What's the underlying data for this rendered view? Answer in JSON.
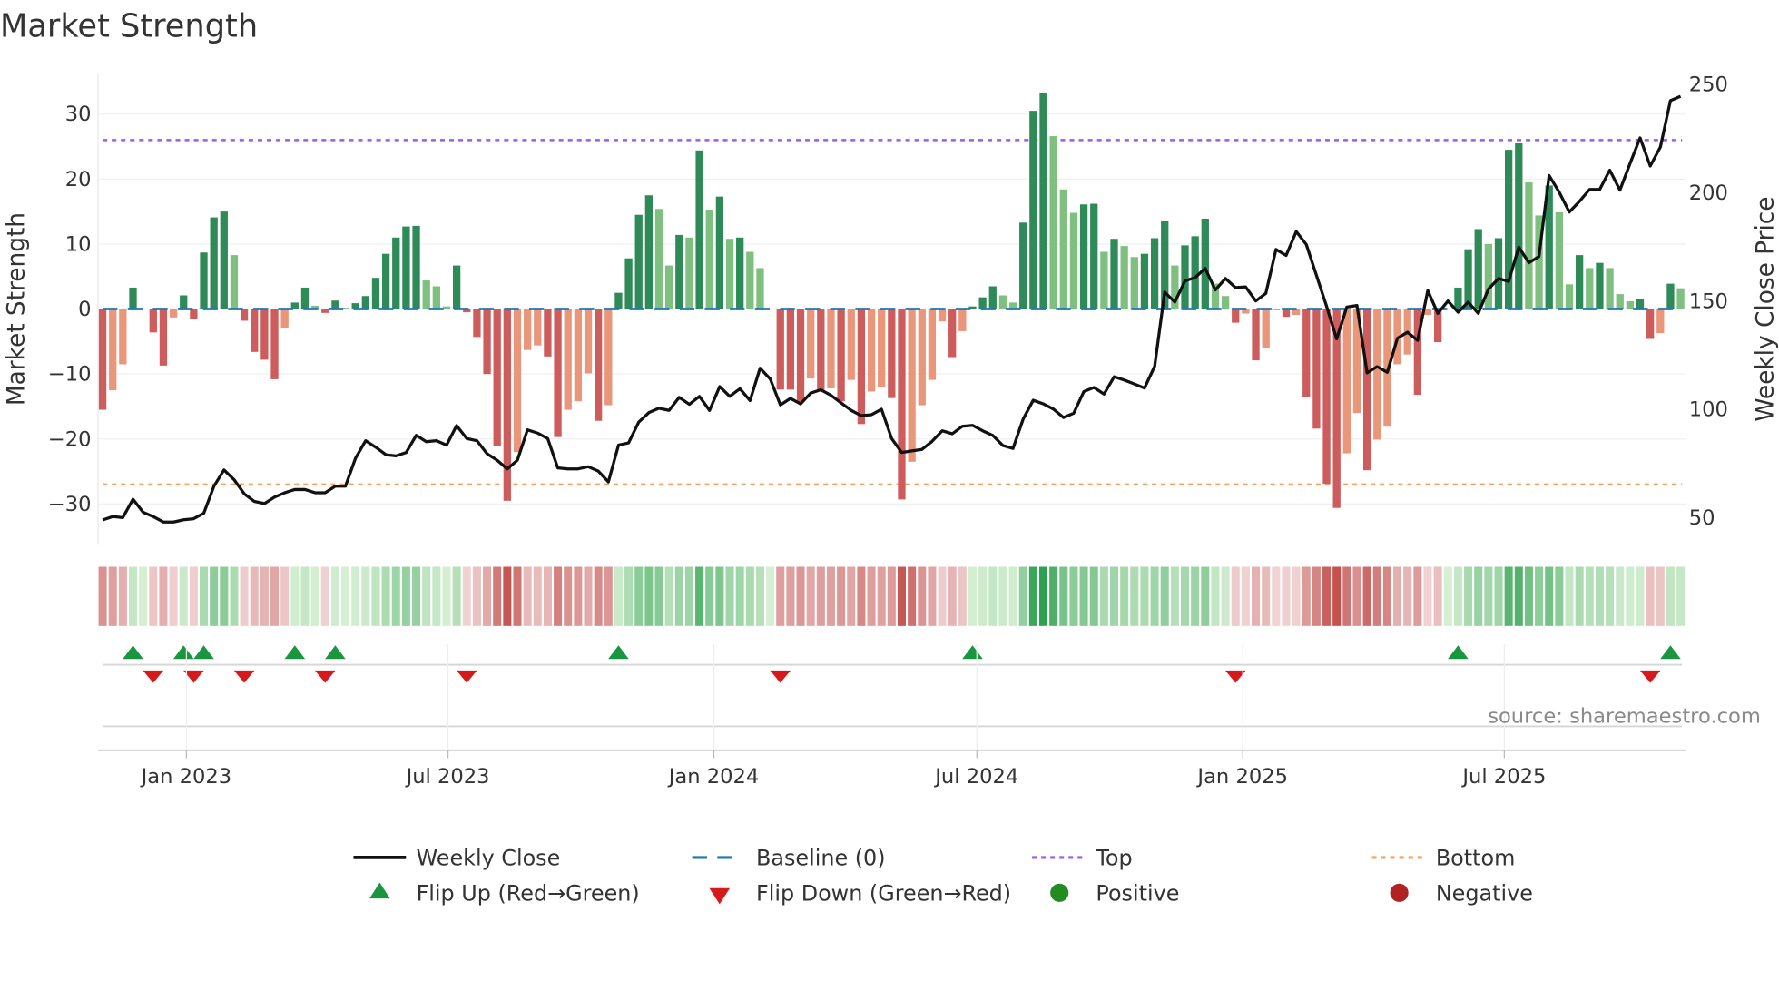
{
  "title": "Market Strength",
  "source": "source: sharemaestro.com",
  "chart_data": {
    "type": "bar",
    "title": "Market Strength",
    "ylabel": "Market Strength",
    "y2label": "Weekly Close Price",
    "ylim": [
      -36,
      37
    ],
    "y2lim": [
      48,
      260
    ],
    "yticks": [
      30,
      20,
      10,
      0,
      -10,
      -20,
      -30
    ],
    "y2ticks": [
      250,
      200,
      150,
      100,
      50
    ],
    "xticks": [
      {
        "label": "Jan 2023",
        "date": "2023-01-01"
      },
      {
        "label": "Jul 2023",
        "date": "2023-07-01"
      },
      {
        "label": "Jan 2024",
        "date": "2024-01-01"
      },
      {
        "label": "Jul 2024",
        "date": "2024-07-01"
      },
      {
        "label": "Jan 2025",
        "date": "2025-01-01"
      },
      {
        "label": "Jul 2025",
        "date": "2025-07-01"
      }
    ],
    "start_date": "2022-11-04",
    "interval_days": 7,
    "grid": true,
    "top_level": 26,
    "bottom_level": -27,
    "baseline": 0,
    "strength": [
      -15.5,
      -12.5,
      -8.5,
      3.3,
      0,
      -3.6,
      -8.7,
      -1.3,
      2.1,
      -1.6,
      8.7,
      14.1,
      15,
      8.3,
      -1.8,
      -6.6,
      -7.8,
      -10.8,
      -3,
      1,
      3.3,
      0.5,
      -0.6,
      1.3,
      0.2,
      0.9,
      2,
      4.8,
      8.5,
      11,
      12.7,
      12.8,
      4.4,
      3.5,
      0.4,
      6.7,
      -0.5,
      -4.3,
      -10,
      -21,
      -29.5,
      -22,
      -6.3,
      -5.6,
      -7.3,
      -19.7,
      -15.5,
      -14.2,
      -9.9,
      -17.2,
      -14.8,
      2.5,
      7.8,
      14.5,
      17.5,
      15.4,
      6.7,
      11.4,
      11,
      24.4,
      15.3,
      17.3,
      10.8,
      11,
      8.8,
      6.3,
      0,
      -12.4,
      -12.4,
      -14.3,
      -10.7,
      -12.4,
      -12.2,
      -14.2,
      -10.9,
      -17.7,
      -12.7,
      -12,
      -13.7,
      -29.3,
      -23.5,
      -14.8,
      -10.9,
      -1.9,
      -7.4,
      -3.4,
      0.4,
      1.8,
      3.5,
      2.1,
      1,
      13.3,
      30.5,
      33.3,
      26.6,
      18.4,
      14.8,
      16.1,
      16.2,
      8.8,
      10.8,
      9.7,
      8,
      8.5,
      10.9,
      13.6,
      6.7,
      9.8,
      11.2,
      13.9,
      3.9,
      2,
      -2.1,
      -0.7,
      -7.9,
      -6,
      -0.2,
      -1.2,
      -0.9,
      -13.6,
      -18.4,
      -26.9,
      -30.6,
      -22.2,
      -16,
      -24.8,
      -20.1,
      -18.1,
      -8.5,
      -7,
      -13.2,
      -0.9,
      -5.1,
      0,
      3.3,
      9.2,
      12.3,
      10,
      10.9,
      24.5,
      25.5,
      19.5,
      14.4,
      19,
      14.9,
      3.8,
      8.3,
      6.3,
      7.1,
      6.3,
      2.3,
      1.2,
      1.6,
      -4.6,
      -3.7,
      3.9,
      3.2
    ],
    "weekly_close": [
      48.4,
      50,
      49.5,
      58,
      52,
      50,
      47.5,
      47.5,
      48.5,
      49,
      51.5,
      64,
      71.5,
      67,
      60.5,
      57,
      56,
      59,
      61,
      62.5,
      62.5,
      61,
      61,
      64,
      64,
      77,
      85,
      82,
      78.5,
      78,
      79.5,
      87.5,
      84.5,
      85,
      83,
      92,
      86,
      85,
      79,
      76,
      72,
      76,
      90,
      88.5,
      86,
      72.5,
      72,
      72,
      73,
      71,
      66,
      83,
      84,
      93.6,
      98,
      100,
      99,
      105,
      101.8,
      105.5,
      99,
      110,
      105.5,
      109,
      103.5,
      118.5,
      113.5,
      101.5,
      104.5,
      102,
      107,
      108.5,
      106,
      102.5,
      99,
      96.6,
      97,
      99.5,
      86,
      79.6,
      80.3,
      81,
      84.7,
      89.6,
      88.2,
      91.7,
      92.1,
      89.6,
      87.4,
      82.8,
      81.4,
      95,
      103.7,
      102,
      99.6,
      95.7,
      97.7,
      107.7,
      109.6,
      106.5,
      114.5,
      113,
      111.2,
      109.3,
      119.3,
      153.6,
      149,
      158.8,
      160.3,
      164.6,
      154.6,
      159.9,
      155.7,
      156,
      149.5,
      153,
      173.3,
      170.5,
      181.6,
      175.6,
      161.3,
      147,
      132,
      146.7,
      147.4,
      116.3,
      119.2,
      116.6,
      132.3,
      135.1,
      131.3,
      154.3,
      143.8,
      149.5,
      144.3,
      149,
      143.8,
      155,
      159.9,
      158.5,
      174.3,
      167.2,
      170,
      207.4,
      199.7,
      190.6,
      195.5,
      201,
      201,
      209.9,
      200.7,
      213,
      224.8,
      211.8,
      220.6,
      242,
      244
    ],
    "flip_up_weeks": [
      3,
      8,
      10,
      19,
      23,
      51,
      86,
      134,
      155
    ],
    "flip_down_weeks": [
      5,
      9,
      14,
      22,
      36,
      67,
      112,
      153
    ],
    "colors": {
      "pos_strong": "#2e8b57",
      "pos_weak": "#7fbf7f",
      "neg_strong": "#cd5c5c",
      "neg_weak": "#e9967a",
      "baseline": "#1f77b4",
      "top": "#9b5de5",
      "bottom": "#f4a460",
      "flip_up": "#1a9641",
      "flip_down": "#d7191c",
      "positive": "#228b22",
      "negative": "#b22222",
      "close": "#111111"
    },
    "legend": {
      "placement": "bottom",
      "entries": [
        "Weekly Close",
        "Baseline (0)",
        "Top",
        "Bottom",
        "Flip Up (Red→Green)",
        "Flip Down (Green→Red)",
        "Positive",
        "Negative"
      ]
    }
  }
}
